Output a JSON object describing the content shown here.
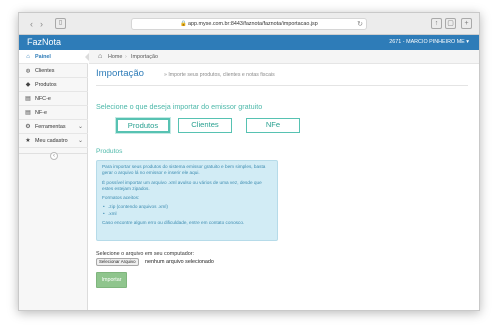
{
  "browser": {
    "url": "app.myse.com.br:8443/faznota/faznota/importacao.jsp",
    "back_glyph": "‹",
    "forward_glyph": "›",
    "reload_glyph": "↻"
  },
  "app": {
    "brand": "FazNota",
    "user": "2671 - MARCIO PINHEIRO ME ▾",
    "accent_color": "#2e7cb8",
    "teal_color": "#57c2b2"
  },
  "sidebar": {
    "items": [
      {
        "icon": "home-icon",
        "glyph": "⌂",
        "label": "Painel",
        "chevron": ""
      },
      {
        "icon": "users-icon",
        "glyph": "👥",
        "label": "Clientes",
        "chevron": ""
      },
      {
        "icon": "tag-icon",
        "glyph": "◆",
        "label": "Produtos",
        "chevron": ""
      },
      {
        "icon": "document-icon",
        "glyph": "▤",
        "label": "NFC-e",
        "chevron": ""
      },
      {
        "icon": "document-icon",
        "glyph": "▤",
        "label": "NF-e",
        "chevron": ""
      },
      {
        "icon": "gear-icon",
        "glyph": "⚙",
        "label": "Ferramentas",
        "chevron": "⌄"
      },
      {
        "icon": "star-icon",
        "glyph": "★",
        "label": "Meu cadastro",
        "chevron": "⌄"
      }
    ],
    "collapse_glyph": "‹"
  },
  "breadcrumb": {
    "home": "Home",
    "separator": "›",
    "current": "Importação"
  },
  "page": {
    "title": "Importação",
    "subtitle": "» Importe seus produtos, clientes e notas fiscais",
    "select_title": "Selecione o que deseja importar do emissor gratuito",
    "choices": [
      "Produtos",
      "Clientes",
      "NFe"
    ],
    "selected_choice": "Produtos",
    "section_title": "Produtos",
    "info": {
      "p1": "Para importar seus produtos do sistema emissor gratuito e bem simples, basta gerar o arquivo lá no emissor e inserir ele aqui.",
      "p2": "É possível importar um arquivo .xml avulso ou vários de uma vez, desde que estes estejam zipados.",
      "formats_label": "Formatos aceitos:",
      "formats": [
        ".zip (contendo arquivos .xml)",
        ".xml"
      ],
      "p3": "Caso encontre algum erro ou dificuldade, entre em contato conosco."
    },
    "file_label": "Selecione o arquivo em seu computador:",
    "file_button": "Selecionar Arquivo",
    "file_status": "nenhum arquivo selecionado",
    "import_button": "Importar"
  }
}
